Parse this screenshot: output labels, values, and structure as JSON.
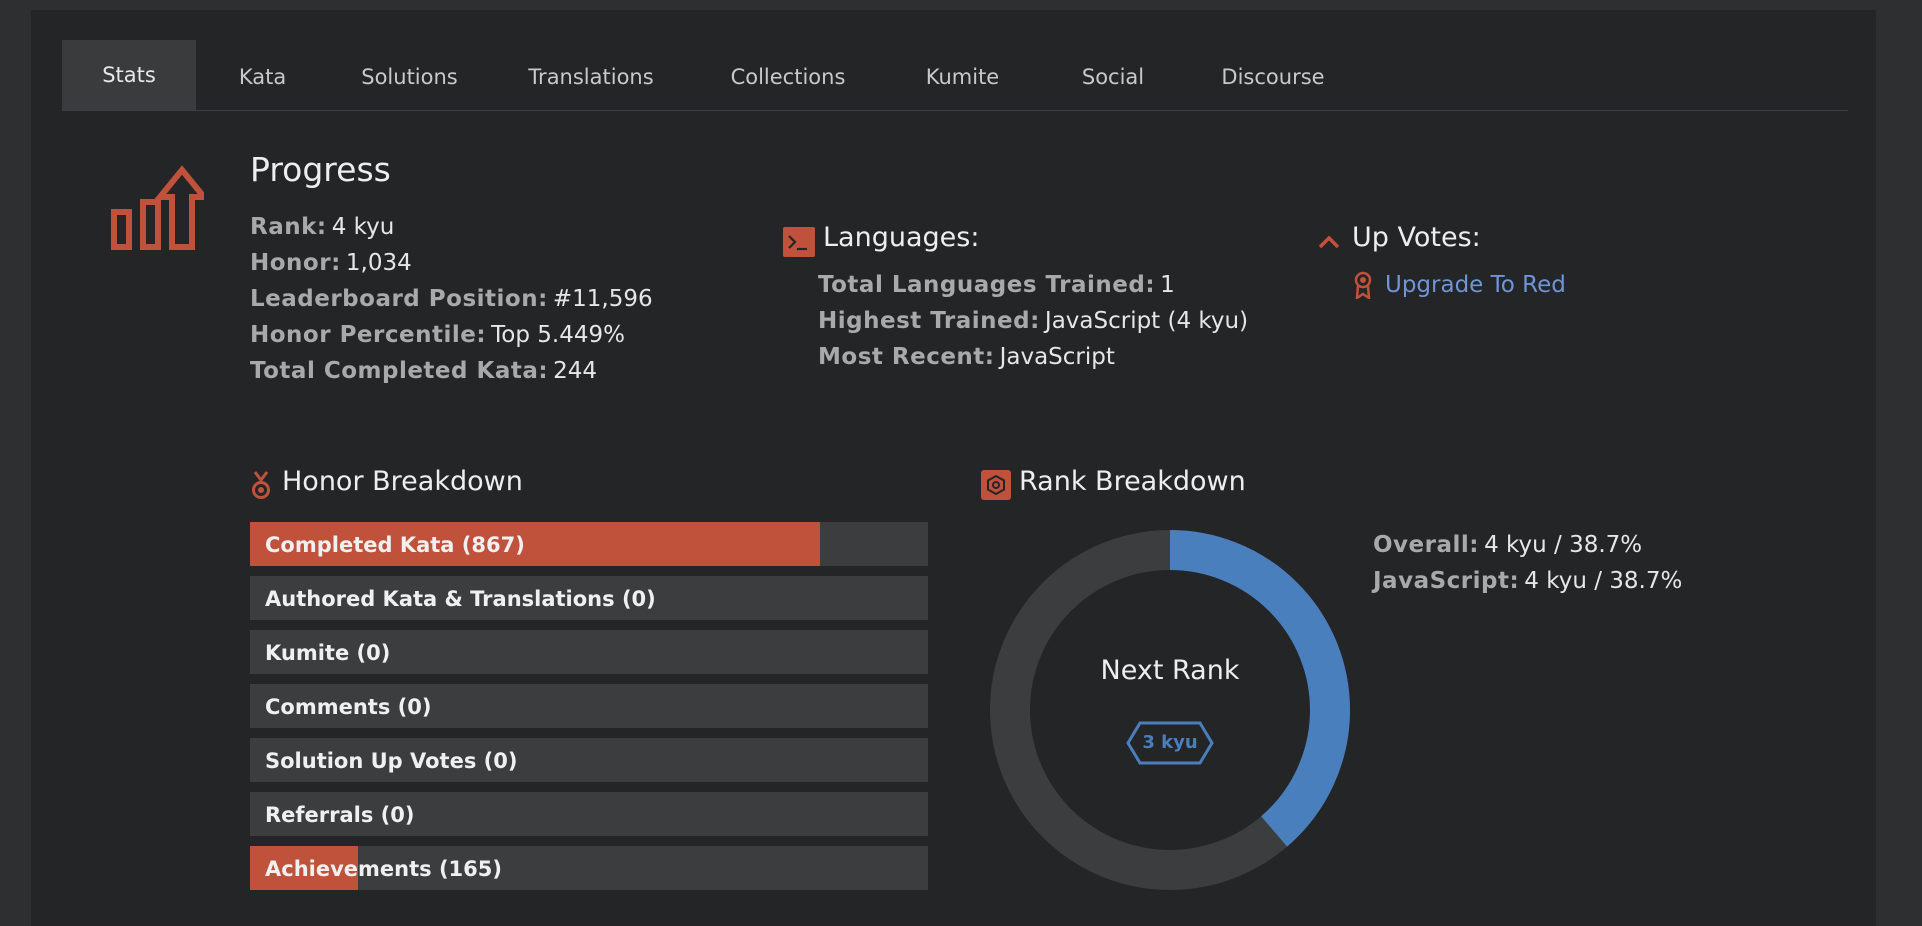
{
  "tabs": [
    "Stats",
    "Kata",
    "Solutions",
    "Translations",
    "Collections",
    "Kumite",
    "Social",
    "Discourse"
  ],
  "progress": {
    "title": "Progress",
    "rows": [
      {
        "label": "Rank:",
        "value": "4 kyu"
      },
      {
        "label": "Honor:",
        "value": "1,034"
      },
      {
        "label": "Leaderboard Position:",
        "value": "#11,596"
      },
      {
        "label": "Honor Percentile:",
        "value": "Top 5.449%"
      },
      {
        "label": "Total Completed Kata:",
        "value": "244"
      }
    ]
  },
  "languages": {
    "title": "Languages:",
    "rows": [
      {
        "label": "Total Languages Trained:",
        "value": "1"
      },
      {
        "label": "Highest Trained:",
        "value": "JavaScript (4 kyu)"
      },
      {
        "label": "Most Recent:",
        "value": "JavaScript"
      }
    ]
  },
  "upvotes": {
    "title": "Up Votes:",
    "link": "Upgrade To Red"
  },
  "honor_breakdown": {
    "title": "Honor Breakdown",
    "bars": [
      {
        "label": "Completed Kata (867)",
        "fill": 0.84
      },
      {
        "label": "Authored Kata & Translations (0)",
        "fill": 0
      },
      {
        "label": "Kumite (0)",
        "fill": 0
      },
      {
        "label": "Comments (0)",
        "fill": 0
      },
      {
        "label": "Solution Up Votes (0)",
        "fill": 0
      },
      {
        "label": "Referrals (0)",
        "fill": 0
      },
      {
        "label": "Achievements (165)",
        "fill": 0.16
      }
    ]
  },
  "rank_breakdown": {
    "title": "Rank Breakdown",
    "center_label": "Next Rank",
    "next_rank": "3 kyu",
    "progress": 0.387,
    "rows": [
      {
        "label": "Overall:",
        "value": "4 kyu / 38.7%"
      },
      {
        "label": "JavaScript:",
        "value": "4 kyu / 38.7%"
      }
    ]
  },
  "colors": {
    "accent": "#c0523c",
    "blue": "#4a7fbd",
    "track": "#3c3d3f"
  }
}
